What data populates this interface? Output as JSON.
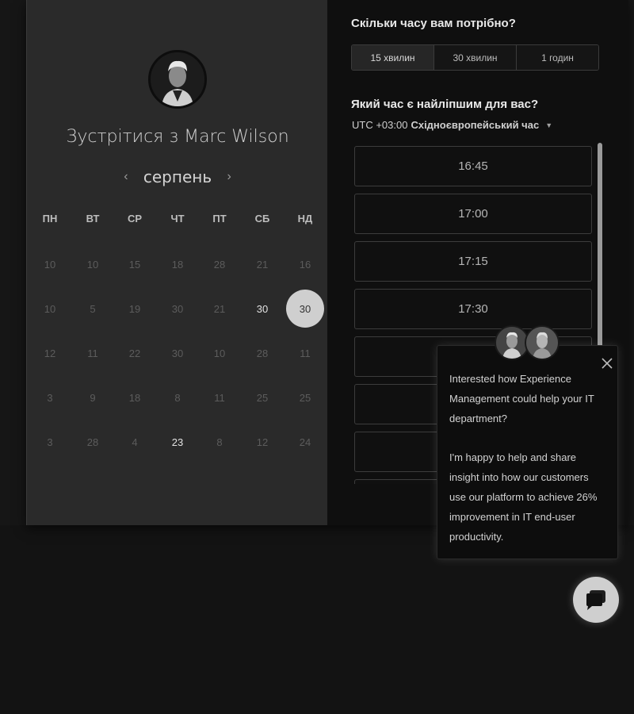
{
  "scheduler": {
    "meet_title": "Зустрітися з Marc Wilson",
    "month": "серпень",
    "prev_icon": "chevron-left-icon",
    "next_icon": "chevron-right-icon",
    "weekdays": [
      "ПН",
      "ВТ",
      "СР",
      "ЧТ",
      "ПТ",
      "СБ",
      "НД"
    ],
    "weeks": [
      [
        "10",
        "10",
        "15",
        "18",
        "28",
        "21",
        "16"
      ],
      [
        "10",
        "5",
        "19",
        "30",
        "21",
        "30",
        "30"
      ],
      [
        "12",
        "11",
        "22",
        "30",
        "10",
        "28",
        "11"
      ],
      [
        "3",
        "9",
        "18",
        "8",
        "11",
        "25",
        "25"
      ],
      [
        "3",
        "28",
        "4",
        "23",
        "8",
        "12",
        "24"
      ]
    ],
    "available_days": [
      [
        1,
        5
      ],
      [
        1,
        6
      ],
      [
        4,
        3
      ]
    ],
    "selected_day": [
      1,
      6
    ]
  },
  "duration": {
    "heading": "Скільки часу вам потрібно?",
    "options": [
      "15 хвилин",
      "30 хвилин",
      "1 годин"
    ],
    "selected": "15 хвилин"
  },
  "time_selection": {
    "heading": "Який час є найліпшим для вас?",
    "timezone_offset": "UTC +03:00",
    "timezone_name": "Східноєвропейський час",
    "slots": [
      "16:45",
      "17:00",
      "17:15",
      "17:30",
      "",
      "",
      "",
      ""
    ]
  },
  "chat": {
    "message_1": "Interested how Experience Management could help your IT department?",
    "message_2": "I'm happy to help and share insight into how our customers use our platform to achieve 26% improvement in IT end-user productivity.",
    "close_icon": "close-icon",
    "launcher_icon": "chat-bubble-icon"
  },
  "colors": {
    "left_panel": "#2a2a2a",
    "right_panel": "#0f0f0f",
    "selected_day": "#cfcfcf"
  }
}
